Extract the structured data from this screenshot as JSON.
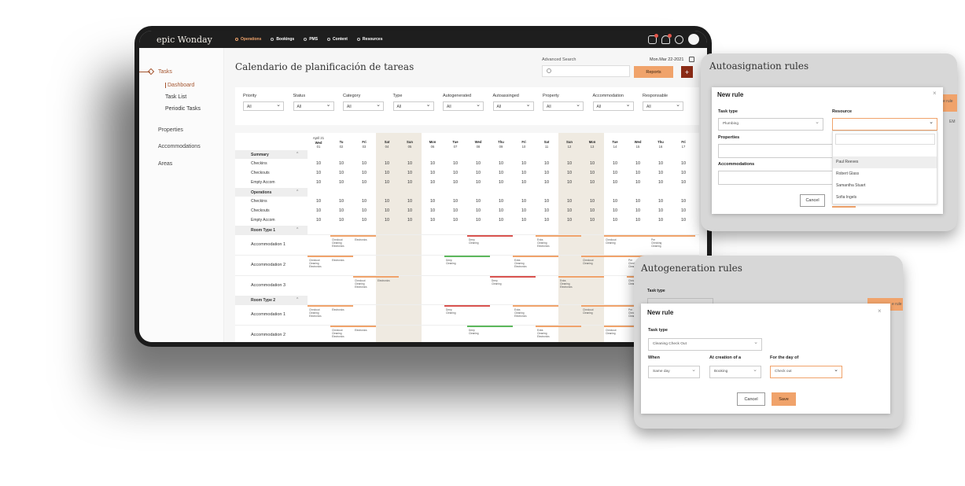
{
  "app": {
    "logo": "epic Wonday"
  },
  "nav": [
    {
      "label": "Operations",
      "active": true
    },
    {
      "label": "Bookings",
      "active": false
    },
    {
      "label": "PMS",
      "active": false
    },
    {
      "label": "Content",
      "active": false
    },
    {
      "label": "Resources",
      "active": false
    }
  ],
  "topbar_icons": [
    "cube-icon",
    "bell-icon",
    "settings-icon",
    "user-avatar"
  ],
  "sidebar": {
    "tasks": "Tasks",
    "sub": [
      "Dashboard",
      "Task List",
      "Periodic Tasks"
    ],
    "active_sub": "Dashboard",
    "items": [
      "Properties",
      "Accommodations",
      "Areas"
    ]
  },
  "page": {
    "title": "Calendario de planificación de tareas",
    "advanced_search": "Advanced Search",
    "date": "Mon.Mar 22-2021",
    "reports": "Reports",
    "add": "+"
  },
  "filters": [
    {
      "label": "Priority",
      "value": "All"
    },
    {
      "label": "Status",
      "value": "All"
    },
    {
      "label": "Category",
      "value": "All"
    },
    {
      "label": "Type",
      "value": "All"
    },
    {
      "label": "Autogenerated",
      "value": "All"
    },
    {
      "label": "Autoassinged",
      "value": "All"
    },
    {
      "label": "Property",
      "value": "All"
    },
    {
      "label": "Accommodation",
      "value": "All"
    },
    {
      "label": "Responsable",
      "value": "All"
    }
  ],
  "calendar": {
    "first_header": {
      "top": "April 21",
      "day": "Wed",
      "num": "01"
    },
    "days": [
      {
        "day": "Tu",
        "num": "02",
        "weekend": false
      },
      {
        "day": "Fri",
        "num": "03",
        "weekend": false
      },
      {
        "day": "Sat",
        "num": "04",
        "weekend": true
      },
      {
        "day": "Sun",
        "num": "05",
        "weekend": true
      },
      {
        "day": "Mon",
        "num": "06",
        "weekend": false
      },
      {
        "day": "Tue",
        "num": "07",
        "weekend": false
      },
      {
        "day": "Wed",
        "num": "08",
        "weekend": false
      },
      {
        "day": "Thu",
        "num": "09",
        "weekend": false
      },
      {
        "day": "Fri",
        "num": "10",
        "weekend": false
      },
      {
        "day": "Sat",
        "num": "11",
        "weekend": false
      },
      {
        "day": "Sun",
        "num": "12",
        "weekend": true
      },
      {
        "day": "Mon",
        "num": "13",
        "weekend": true
      },
      {
        "day": "Tue",
        "num": "14",
        "weekend": false
      },
      {
        "day": "Wed",
        "num": "15",
        "weekend": false
      },
      {
        "day": "Thu",
        "num": "16",
        "weekend": false
      },
      {
        "day": "Fri",
        "num": "17",
        "weekend": false
      }
    ],
    "sections": [
      {
        "label": "Summary",
        "rows": [
          "Checkins",
          "Checkouts",
          "Empty Accom"
        ]
      },
      {
        "label": "Operations",
        "rows": [
          "Checkins",
          "Checkouts",
          "Empty Accom"
        ]
      }
    ],
    "cell_value": "10",
    "room_types": [
      {
        "label": "Room Type 1",
        "accommodations": [
          "Accommodation 1",
          "Accommodation 2",
          "Accommodation 3"
        ]
      },
      {
        "label": "Room Type 2",
        "accommodations": [
          "Accommodation 1",
          "Accommodation 2"
        ]
      }
    ],
    "task_labels": {
      "cce": "Checkout\nCleaning\nElectronics",
      "electronics": "Electronics",
      "deep": "Deep\nCleaning",
      "extra": "Extra\nCleaning\nElectronics",
      "checkout": "Checkout\nCleaning",
      "pre": "Pre\nChecking\nCleaning"
    }
  },
  "autoasignation": {
    "panel_title": "Autoasignation rules",
    "modal_title": "New rule",
    "close": "×",
    "task_type_label": "Task type",
    "task_type_value": "Plumbing",
    "resource_label": "Resource",
    "properties_label": "Properties",
    "accommodations_label": "Accommodations",
    "resource_options": [
      "Paul Reeves",
      "Robert Glass",
      "Samantha Stuart",
      "Sofia Ingels"
    ],
    "cancel": "Cancel",
    "bg_partial": "e rule",
    "bg_partial2": "EM"
  },
  "autogeneration": {
    "panel_title": "Autogeneration rules",
    "bg_task_type": "Task type",
    "bg_partial": "e rule",
    "modal_title": "New rule",
    "close": "×",
    "task_type_label": "Task type",
    "task_type_value": "Cleaning Check Out",
    "when_label": "When",
    "when_value": "Same day",
    "at_creation_label": "At creation of a",
    "at_creation_value": "Booking",
    "for_day_label": "For the day of",
    "for_day_value": "Check out",
    "cancel": "Cancel",
    "save": "Save"
  },
  "colors": {
    "accent": "#f0a36b",
    "brand_dark": "#8b2b16",
    "active_red": "#a4542e",
    "bar_red": "#d9534f",
    "bar_green": "#5cb85c"
  }
}
